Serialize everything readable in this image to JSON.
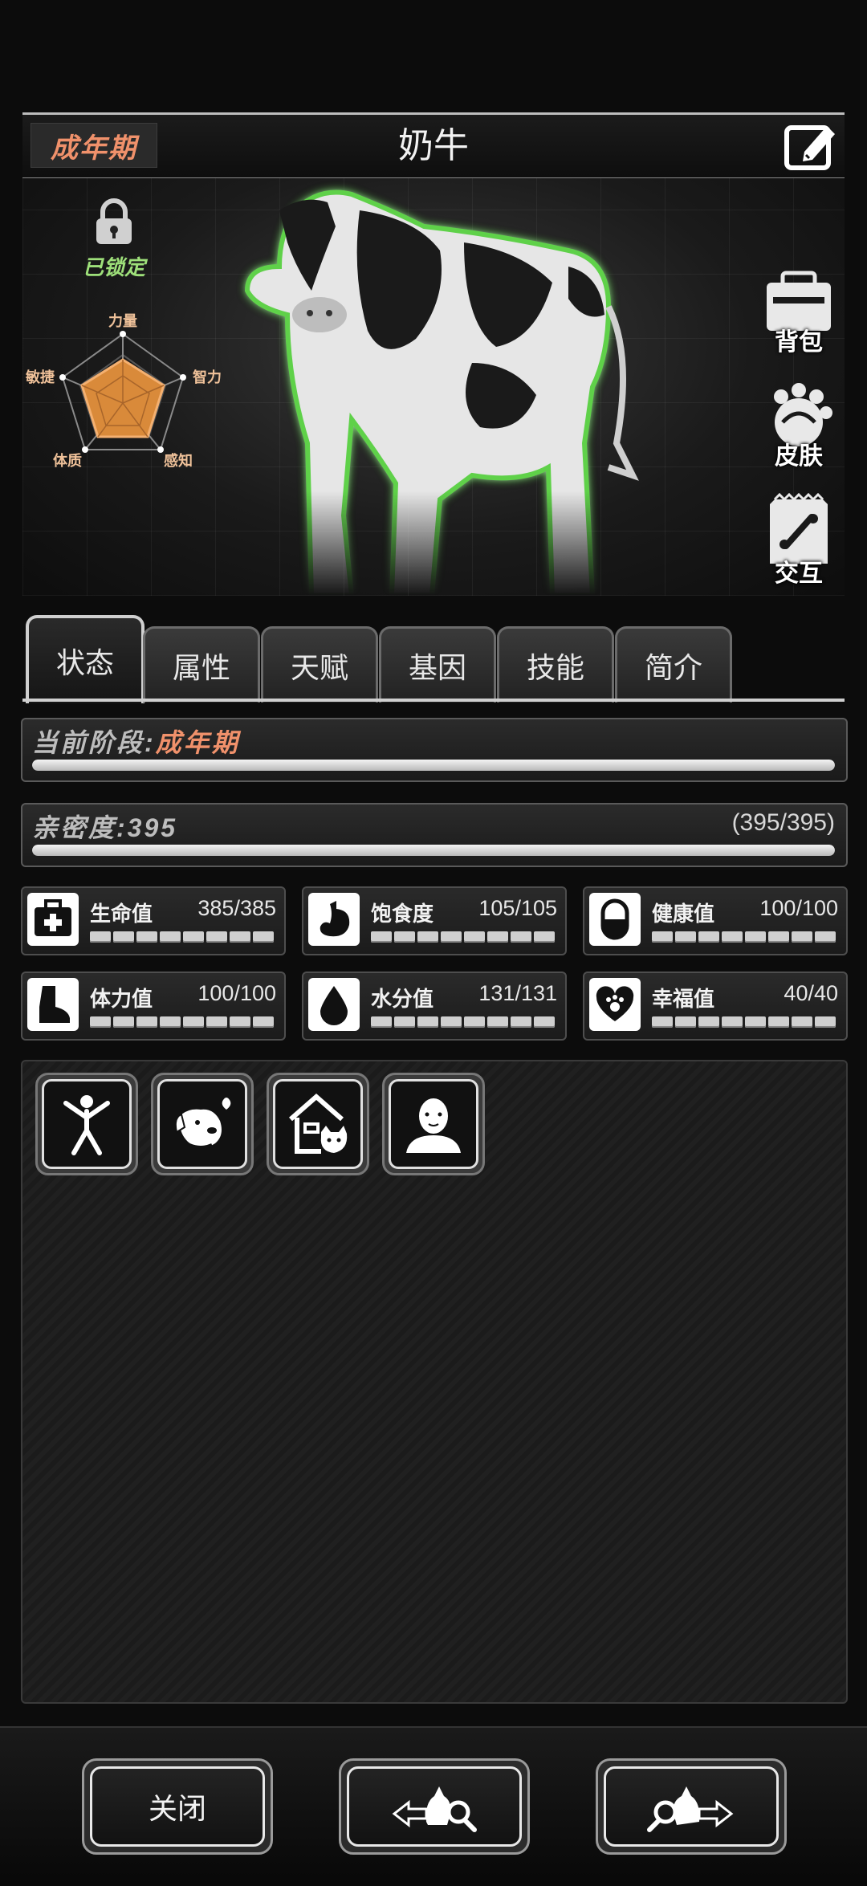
{
  "header": {
    "stage": "成年期",
    "title": "奶牛"
  },
  "lock": {
    "label": "已锁定"
  },
  "radar": {
    "labels": [
      "力量",
      "智力",
      "感知",
      "体质",
      "敏捷"
    ]
  },
  "side_buttons": [
    {
      "label": "背包",
      "icon": "backpack-icon"
    },
    {
      "label": "皮肤",
      "icon": "paw-skin-icon"
    },
    {
      "label": "交互",
      "icon": "bone-icon"
    }
  ],
  "tabs": [
    "状态",
    "属性",
    "天赋",
    "基因",
    "技能",
    "简介"
  ],
  "stage_bar": {
    "label": "当前阶段:",
    "value": "成年期",
    "progress": 1.0
  },
  "intimacy_bar": {
    "label": "亲密度:395",
    "count": "(395/395)",
    "progress": 1.0
  },
  "stats": [
    {
      "name": "生命值",
      "value": "385/385",
      "icon": "medkit-icon",
      "fill": 1.0
    },
    {
      "name": "饱食度",
      "value": "105/105",
      "icon": "stomach-icon",
      "fill": 1.0
    },
    {
      "name": "健康值",
      "value": "100/100",
      "icon": "pill-icon",
      "fill": 1.0
    },
    {
      "name": "体力值",
      "value": "100/100",
      "icon": "foot-icon",
      "fill": 1.0
    },
    {
      "name": "水分值",
      "value": "131/131",
      "icon": "water-drop-icon",
      "fill": 1.0
    },
    {
      "name": "幸福值",
      "value": "40/40",
      "icon": "heart-paw-icon",
      "fill": 1.0
    }
  ],
  "actions": [
    "stretch-person-icon",
    "dog-love-icon",
    "pet-house-icon",
    "person-avatar-icon"
  ],
  "footer": {
    "close_label": "关闭"
  },
  "colors": {
    "accent": "#f0916b",
    "locked": "#9ee07a",
    "radar_fill": "#d98a3a"
  }
}
